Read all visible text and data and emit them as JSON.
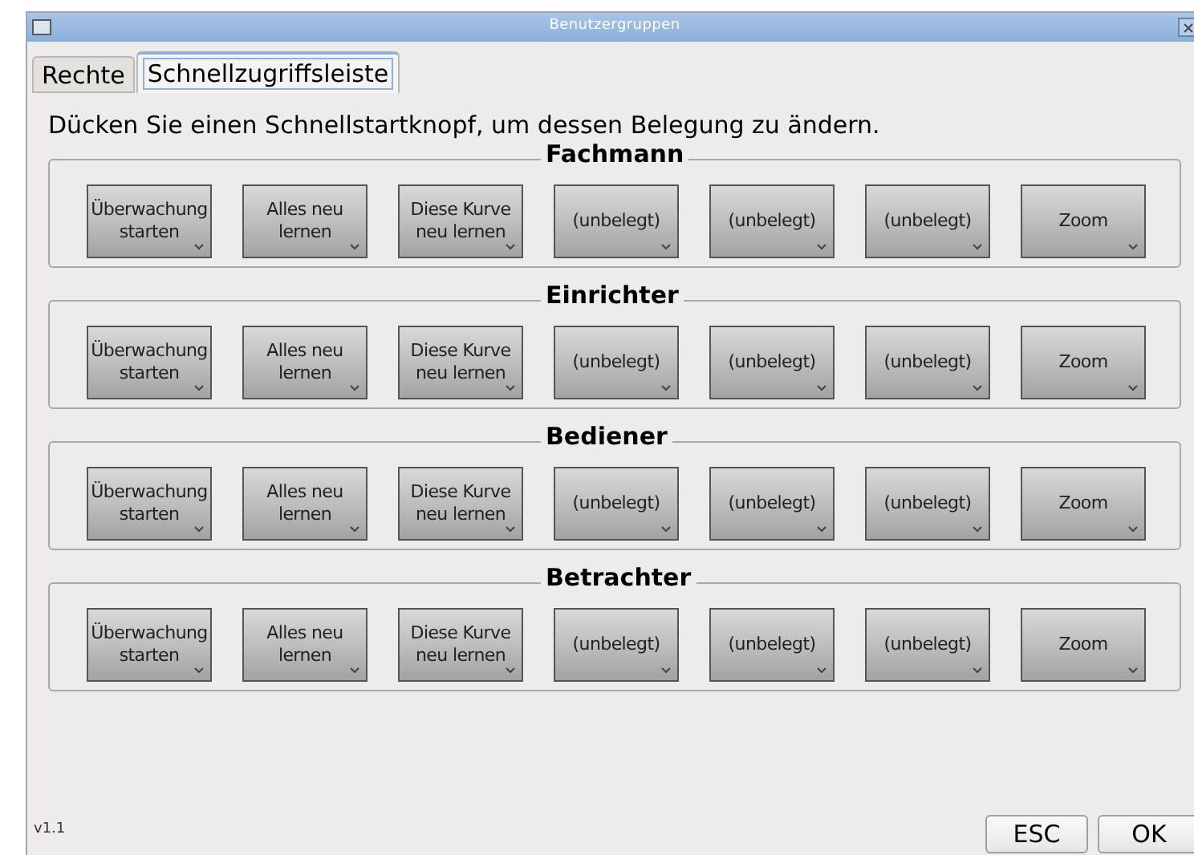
{
  "window": {
    "title": "Benutzergruppen"
  },
  "tabs": [
    {
      "label": "Rechte",
      "selected": false
    },
    {
      "label": "Schnellzugriffsleiste",
      "selected": true
    }
  ],
  "instruction": "Dücken Sie einen Schnellstartknopf, um dessen Belegung zu ändern.",
  "groups": [
    {
      "title": "Fachmann",
      "buttons": [
        "Überwachung starten",
        "Alles neu lernen",
        "Diese Kurve neu lernen",
        "(unbelegt)",
        "(unbelegt)",
        "(unbelegt)",
        "Zoom"
      ]
    },
    {
      "title": "Einrichter",
      "buttons": [
        "Überwachung starten",
        "Alles neu lernen",
        "Diese Kurve neu lernen",
        "(unbelegt)",
        "(unbelegt)",
        "(unbelegt)",
        "Zoom"
      ]
    },
    {
      "title": "Bediener",
      "buttons": [
        "Überwachung starten",
        "Alles neu lernen",
        "Diese Kurve neu lernen",
        "(unbelegt)",
        "(unbelegt)",
        "(unbelegt)",
        "Zoom"
      ]
    },
    {
      "title": "Betrachter",
      "buttons": [
        "Überwachung starten",
        "Alles neu lernen",
        "Diese Kurve neu lernen",
        "(unbelegt)",
        "(unbelegt)",
        "(unbelegt)",
        "Zoom"
      ]
    }
  ],
  "version": "v1.1",
  "buttons": [
    "ESC",
    "OK"
  ]
}
